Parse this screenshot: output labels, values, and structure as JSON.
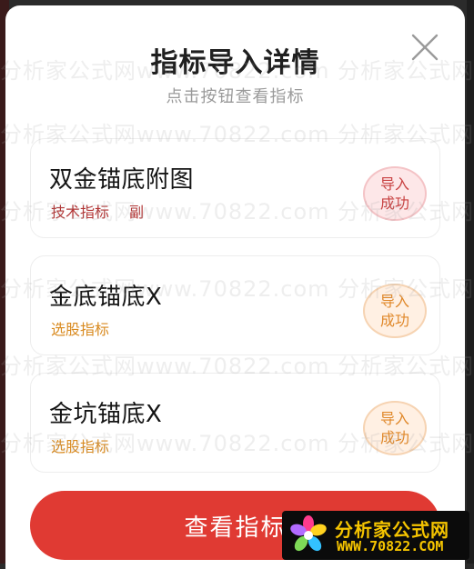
{
  "dialog": {
    "title": "指标导入详情",
    "subtitle": "点击按钮查看指标",
    "close_icon": "close-icon"
  },
  "cards": [
    {
      "name": "双金锚底附图",
      "tags": [
        "技术指标",
        "副"
      ],
      "tag_color": "#b23333",
      "status": [
        "导入",
        "成功"
      ],
      "status_color": "#c84141"
    },
    {
      "name": "金底锚底X",
      "tags": [
        "选股指标"
      ],
      "tag_color": "#d98a1f",
      "status": [
        "导入",
        "成功"
      ],
      "status_color": "#e0882a"
    },
    {
      "name": "金坑锚底X",
      "tags": [
        "选股指标"
      ],
      "tag_color": "#d98a1f",
      "status": [
        "导入",
        "成功"
      ],
      "status_color": "#e0882a"
    }
  ],
  "button": {
    "label": "查看指标",
    "color": "#e03a33"
  },
  "watermark": {
    "line_a": "分析家公式网www.70822.com  分析家公式网",
    "line_b": "分析家公式网www.70822.com  分析家公式网"
  },
  "logo": {
    "name": "分析家公式网",
    "url": "WWW.70822.COM"
  }
}
